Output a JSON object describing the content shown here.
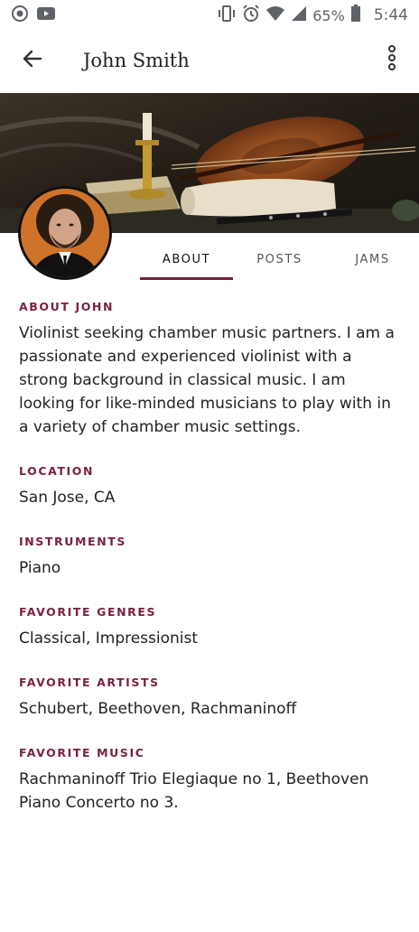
{
  "status_bar": {
    "battery_percent": "65%",
    "time": "5:44",
    "icons": [
      "record-icon",
      "youtube-icon",
      "vibrate-icon",
      "alarm-icon",
      "wifi-icon",
      "signal-icon",
      "battery-icon"
    ]
  },
  "app_bar": {
    "title": "John Smith",
    "back_icon": "arrow-back-icon",
    "more_icon": "more-vert-icon"
  },
  "tabs": [
    {
      "label": "ABOUT",
      "active": true
    },
    {
      "label": "POSTS",
      "active": false
    },
    {
      "label": "JAMS",
      "active": false
    }
  ],
  "accent_color": "#7a1f40",
  "profile": {
    "sections": [
      {
        "label": "ABOUT JOHN",
        "text": "Violinist seeking chamber music partners. I am a passionate and experienced violinist with a strong background in classical music. I am looking for like-minded musicians to play with in a variety of chamber music settings."
      },
      {
        "label": "LOCATION",
        "text": "San Jose, CA"
      },
      {
        "label": "INSTRUMENTS",
        "text": "Piano"
      },
      {
        "label": "FAVORITE GENRES",
        "text": "Classical, Impressionist"
      },
      {
        "label": "FAVORITE ARTISTS",
        "text": "Schubert, Beethoven, Rachmaninoff"
      },
      {
        "label": "FAVORITE MUSIC",
        "text": "Rachmaninoff Trio Elegiaque no 1, Beethoven Piano Concerto no 3."
      }
    ]
  }
}
